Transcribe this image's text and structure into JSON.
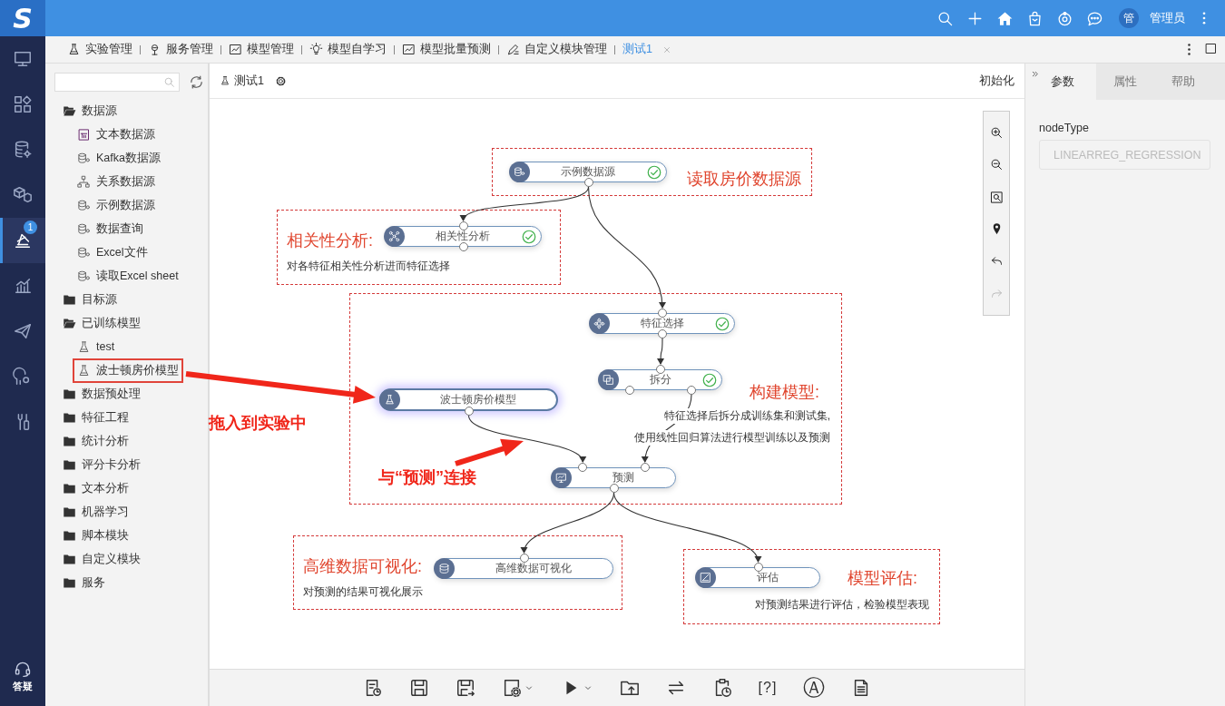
{
  "top_bar": {
    "logo": "S",
    "actions": [
      {
        "kind": "search"
      },
      {
        "kind": "plus"
      },
      {
        "kind": "home"
      },
      {
        "kind": "bag"
      },
      {
        "kind": "orbit"
      },
      {
        "kind": "chat"
      }
    ],
    "user_avatar": "管",
    "user_name": "管理员"
  },
  "nav": {
    "items": [
      {
        "kind": "monitor",
        "selected": false
      },
      {
        "kind": "grid",
        "selected": false
      },
      {
        "kind": "database",
        "selected": false
      },
      {
        "kind": "cubes",
        "selected": false
      },
      {
        "kind": "experiment",
        "selected": true,
        "badge": "1"
      },
      {
        "kind": "chart",
        "selected": false
      },
      {
        "kind": "plane",
        "selected": false
      },
      {
        "kind": "usergear",
        "selected": false
      },
      {
        "kind": "tools",
        "selected": false
      }
    ],
    "help": "答疑"
  },
  "tabs": [
    {
      "label": "实验管理",
      "kind": "flask",
      "selected": false,
      "closable": false
    },
    {
      "label": "服务管理",
      "kind": "service",
      "selected": false,
      "closable": false
    },
    {
      "label": "模型管理",
      "kind": "linechart",
      "selected": false,
      "closable": false
    },
    {
      "label": "模型自学习",
      "kind": "bulb",
      "selected": false,
      "closable": false
    },
    {
      "label": "模型批量预测",
      "kind": "linechart",
      "selected": false,
      "closable": false
    },
    {
      "label": "自定义模块管理",
      "kind": "pen",
      "selected": false,
      "closable": false
    },
    {
      "label": "测试1",
      "kind": "none",
      "selected": true,
      "closable": true
    }
  ],
  "tree": [
    {
      "label": "数据源",
      "expanded": true,
      "children": [
        {
          "label": "文本数据源",
          "kind": "txt",
          "marked": false
        },
        {
          "label": "Kafka数据源",
          "kind": "db",
          "marked": false
        },
        {
          "label": "关系数据源",
          "kind": "relation",
          "marked": false
        },
        {
          "label": "示例数据源",
          "kind": "db",
          "marked": false
        },
        {
          "label": "数据查询",
          "kind": "db",
          "marked": false
        },
        {
          "label": "Excel文件",
          "kind": "db",
          "marked": false
        },
        {
          "label": "读取Excel sheet",
          "kind": "db",
          "marked": false
        }
      ]
    },
    {
      "label": "目标源",
      "expanded": false
    },
    {
      "label": "已训练模型",
      "expanded": true,
      "children": [
        {
          "label": "test",
          "kind": "flask",
          "marked": false
        },
        {
          "label": "波士顿房价模型",
          "kind": "flask",
          "marked": true
        }
      ]
    },
    {
      "label": "数据预处理",
      "expanded": false
    },
    {
      "label": "特征工程",
      "expanded": false
    },
    {
      "label": "统计分析",
      "expanded": false
    },
    {
      "label": "评分卡分析",
      "expanded": false
    },
    {
      "label": "文本分析",
      "expanded": false
    },
    {
      "label": "机器学习",
      "expanded": false
    },
    {
      "label": "脚本模块",
      "expanded": false
    },
    {
      "label": "自定义模块",
      "expanded": false
    },
    {
      "label": "服务",
      "expanded": false
    }
  ],
  "canvas": {
    "title": "测试1",
    "action": "初始化",
    "nodes": [
      {
        "label": "示例数据源",
        "kind": "datasource",
        "done": true,
        "selected": false
      },
      {
        "label": "相关性分析",
        "kind": "network",
        "done": true,
        "selected": false
      },
      {
        "label": "特征选择",
        "kind": "feature",
        "done": true,
        "selected": false
      },
      {
        "label": "拆分",
        "kind": "split",
        "done": true,
        "selected": false
      },
      {
        "label": "波士顿房价模型",
        "kind": "flask",
        "done": false,
        "selected": true
      },
      {
        "label": "预测",
        "kind": "predict",
        "done": false,
        "selected": false
      },
      {
        "label": "高维数据可视化",
        "kind": "dbstack",
        "done": false,
        "selected": false
      },
      {
        "label": "评估",
        "kind": "evaluate",
        "done": false,
        "selected": false
      }
    ],
    "annotations": [
      {
        "title": "读取房价数据源"
      },
      {
        "title": "相关性分析:",
        "lines": [
          "对各特征相关性分析进而特征选择"
        ]
      },
      {
        "title": "构建模型:",
        "lines": [
          "特征选择后拆分成训练集和测试集,",
          "使用线性回归算法进行模型训练以及预测"
        ]
      },
      {
        "title": "高维数据可视化:",
        "lines": [
          "对预测的结果可视化展示"
        ]
      },
      {
        "title": "模型评估:",
        "lines": [
          "对预测结果进行评估，检验模型表现"
        ]
      }
    ],
    "zoom_tools": [
      {
        "kind": "zoomin",
        "disabled": false
      },
      {
        "kind": "zoomout",
        "disabled": false
      },
      {
        "kind": "fit",
        "disabled": false
      },
      {
        "kind": "pin",
        "disabled": false
      },
      {
        "kind": "undo",
        "disabled": false
      },
      {
        "kind": "redo",
        "disabled": true
      }
    ],
    "callouts": [
      "拖入到实验中",
      "与“预测”连接"
    ],
    "toolbar": [
      {
        "kind": "report",
        "dropdown": false
      },
      {
        "kind": "save",
        "dropdown": false
      },
      {
        "kind": "saveas",
        "dropdown": false
      },
      {
        "kind": "settingsdoc",
        "dropdown": true
      },
      {
        "kind": "play",
        "dropdown": true
      },
      {
        "kind": "upload",
        "dropdown": false
      },
      {
        "kind": "swap",
        "dropdown": false
      },
      {
        "kind": "clipclock",
        "dropdown": false
      },
      {
        "kind": "glyph",
        "glyph": "[?]",
        "dropdown": false
      },
      {
        "kind": "glyph",
        "glyph": "Ⓐ",
        "dropdown": false
      },
      {
        "kind": "doc",
        "dropdown": false
      }
    ]
  },
  "properties": {
    "tabs": [
      {
        "label": "参数",
        "selected": true
      },
      {
        "label": "属性",
        "selected": false
      },
      {
        "label": "帮助",
        "selected": false
      }
    ],
    "field_label": "nodeType",
    "field_value": "LINEARREG_REGRESSION",
    "field_disabled": true
  }
}
